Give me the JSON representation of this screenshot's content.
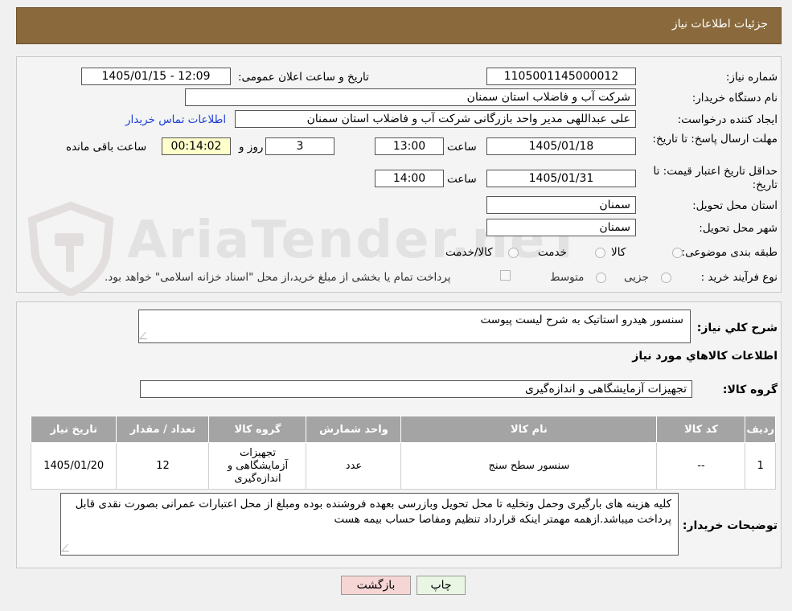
{
  "header": {
    "title": "جزئیات اطلاعات نیاز"
  },
  "watermark": {
    "text": "AriaTender.neT",
    "icon": "shield-hammer-icon"
  },
  "form": {
    "need_number_label": "شماره نیاز:",
    "need_number": "1105001145000012",
    "announce_label": "تاریخ و ساعت اعلان عمومی:",
    "announce_value": "1405/01/15 - 12:09",
    "buyer_org_label": "نام دستگاه خریدار:",
    "buyer_org": "شرکت آب و فاضلاب استان سمنان",
    "requester_label": "ایجاد کننده درخواست:",
    "requester": "علی عبداللهی مدیر واحد بازرگانی شرکت آب و فاضلاب استان سمنان",
    "contact_link": "اطلاعات تماس خریدار",
    "deadline_label": "مهلت ارسال پاسخ: تا تاریخ:",
    "deadline_date": "1405/01/18",
    "time_label": "ساعت",
    "deadline_time": "13:00",
    "days_value": "3",
    "days_label": "روز و",
    "remaining_time": "00:14:02",
    "remaining_label": "ساعت باقی مانده",
    "price_valid_label": "حداقل تاریخ اعتبار قیمت: تا تاریخ:",
    "price_valid_date": "1405/01/31",
    "price_valid_time": "14:00",
    "province_label": "استان محل تحویل:",
    "province": "سمنان",
    "city_label": "شهر محل تحویل:",
    "city": "سمنان",
    "category_label": "طبقه بندی موضوعی:",
    "category_options": [
      "کالا",
      "خدمت",
      "کالا/خدمت"
    ],
    "process_label": "نوع فرآیند خرید :",
    "process_options": [
      "جزیی",
      "متوسط"
    ],
    "payment_note": "پرداخت تمام یا بخشی از مبلغ خرید،از محل \"اسناد خزانه اسلامی\" خواهد بود."
  },
  "details": {
    "summary_label": "شرح کلي نياز:",
    "summary": "سنسور هیدرو استاتیک به شرح لیست پیوست",
    "goods_info_title": "اطلاعات کالاهاي مورد نياز",
    "group_label": "گروه کالا:",
    "group_value": "تجهیزات آزمایشگاهی و اندازه‌گیری",
    "table": {
      "headers": [
        "ردیف",
        "کد کالا",
        "نام کالا",
        "واحد شمارش",
        "گروه کالا",
        "تعداد / مقدار",
        "تاریخ نیاز"
      ],
      "rows": [
        [
          "1",
          "--",
          "سنسور سطح سنج",
          "عدد",
          "تجهیزات آزمایشگاهی و اندازه‌گیری",
          "12",
          "1405/01/20"
        ]
      ]
    },
    "buyer_notes_label": "توضیحات خریدار:",
    "buyer_notes": "کلیه هزینه های بارگیری وحمل وتخلیه تا محل تحویل وبازرسی بعهده فروشنده بوده ومبلغ از محل اعتبارات عمرانی  بصورت نقدی قابل پرداخت میباشد.ازهمه مهمتر اینکه قرارداد تنظیم ومفاصا حساب بیمه هست"
  },
  "buttons": {
    "print": "چاپ",
    "back": "بازگشت"
  },
  "colors": {
    "header_bg": "#8a6a3c",
    "link": "#1a3fd8",
    "table_header": "#a4a4a4",
    "back_button": "#f6d5d5",
    "print_button": "#eaf6e4"
  }
}
